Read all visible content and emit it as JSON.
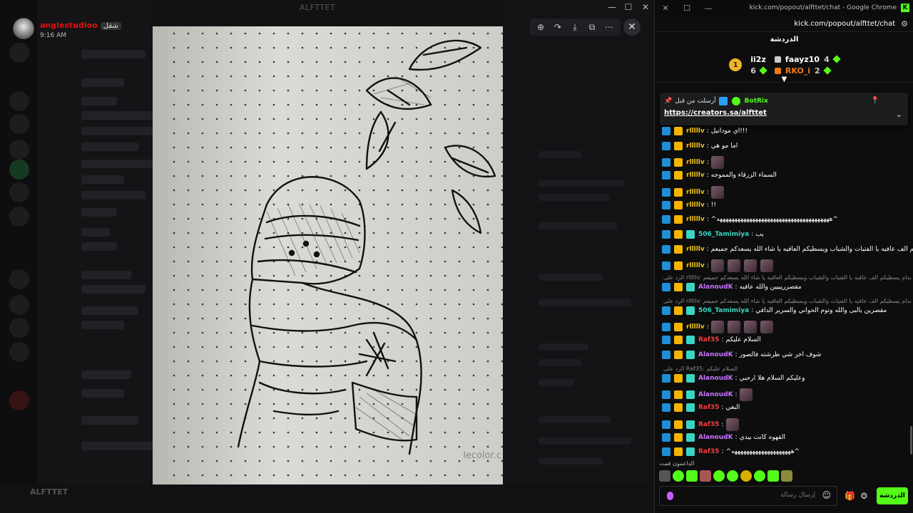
{
  "discord": {
    "window_title": "ALFTTET",
    "window_controls": [
      "—",
      "☐",
      "✕"
    ],
    "user": {
      "name": "anglestudioo",
      "tag": "شقل",
      "time": "9:16 AM"
    },
    "toolbar": [
      "zoom-in",
      "forward",
      "download",
      "open-external",
      "more"
    ],
    "watermark": "lecolor.c",
    "footer_name": "ALFTTET"
  },
  "kick": {
    "window_title": "kick.com/popout/alfttet/chat - Google Chrome",
    "url": "kick.com/popout/alfttet/chat",
    "chat_title": "الدردشة",
    "leaderboard": {
      "rank": "1",
      "left": [
        {
          "name": "ii2z",
          "count": "6"
        }
      ],
      "right": [
        {
          "name": "faayz10",
          "count": "4",
          "color": "#ffffff"
        },
        {
          "name": "RKO_i",
          "count": "2",
          "color": "#f07a1a"
        }
      ]
    },
    "pinned": {
      "label": "أرسلت من قبل",
      "author": "BotRix",
      "link": "https://creators.sa/alfttet"
    },
    "messages": [
      {
        "name": "rlllllv",
        "color": "#f0c419",
        "text": "اي مودانيل!!!"
      },
      {
        "name": "rlllllv",
        "color": "#f0c419",
        "text": "اما مو هي"
      },
      {
        "name": "rlllllv",
        "color": "#f0c419",
        "text": "",
        "emotes": 1
      },
      {
        "name": "rlllllv",
        "color": "#f0c419",
        "text": "السماء الزرقاء والمموجه"
      },
      {
        "name": "rlllllv",
        "color": "#f0c419",
        "text": "",
        "emotes": 1
      },
      {
        "name": "rlllllv",
        "color": "#f0c419",
        "text": "!!"
      },
      {
        "name": "rlllllv",
        "color": "#f0c419",
        "text": "^ههههههههههههههههههههههههههههههههههههههه^"
      },
      {
        "name": "506_Tamimiya",
        "color": "#38d5c4",
        "text": "يب"
      },
      {
        "name": "rlllllv",
        "color": "#f0c419",
        "text": "انا استاذنكم بدام يسطيكم الف عافيه يا الفتيات والشباب ويسطيكم العافيه يا شاء الله يسعدكم جميعم"
      },
      {
        "name": "rlllllv",
        "color": "#f0c419",
        "text": "",
        "emotes": 4
      },
      {
        "reply": "الرد على rlllllv: انا استاذنكم بدام يسطيكم الف عافيه يا الفتيات والشباب ويسطيكم العافيه يا شاء الله يسعدكم جميعم"
      },
      {
        "name": "AlanoudK",
        "color": "#c775ff",
        "text": "مقصرريييين والله عافيه"
      },
      {
        "reply": "الرد على rlllllv: انا استاذنكم بدام يسطيكم الف عافيه يا الفتيات والشباب ويسطيكم العافيه يا شاء الله يسعدكم جميعم"
      },
      {
        "name": "506_Tamimiya",
        "color": "#38d5c4",
        "text": "مقصرين يالبى والله وتوم الحواني والسرير الدافي"
      },
      {
        "name": "rlllllv",
        "color": "#f0c419",
        "text": "",
        "emotes": 4
      },
      {
        "name": "Raf35",
        "color": "#ff3b3b",
        "text": "السلام عليكم"
      },
      {
        "name": "AlanoudK",
        "color": "#c775ff",
        "text": "شوف اخر شي طرشته فالصور"
      },
      {
        "reply": "الرد على Raf35: السلام عليكم"
      },
      {
        "name": "AlanoudK",
        "color": "#c775ff",
        "text": "وعليكم السلام هلا ارحبي"
      },
      {
        "name": "AlanoudK",
        "color": "#c775ff",
        "text": "",
        "emotes": 1
      },
      {
        "name": "Raf35",
        "color": "#ff3b3b",
        "text": "البغي"
      },
      {
        "name": "Raf35",
        "color": "#ff3b3b",
        "text": "",
        "emotes": 1
      },
      {
        "name": "AlanoudK",
        "color": "#c775ff",
        "text": "القهوه كانت بيدي"
      },
      {
        "name": "Raf35",
        "color": "#ff3b3b",
        "text": "^ههههههههههههههههههههه^"
      }
    ],
    "supporters_label": "الداعمون قمت",
    "input_placeholder": "إرسال رسالة",
    "send_label": "الدردشة"
  }
}
